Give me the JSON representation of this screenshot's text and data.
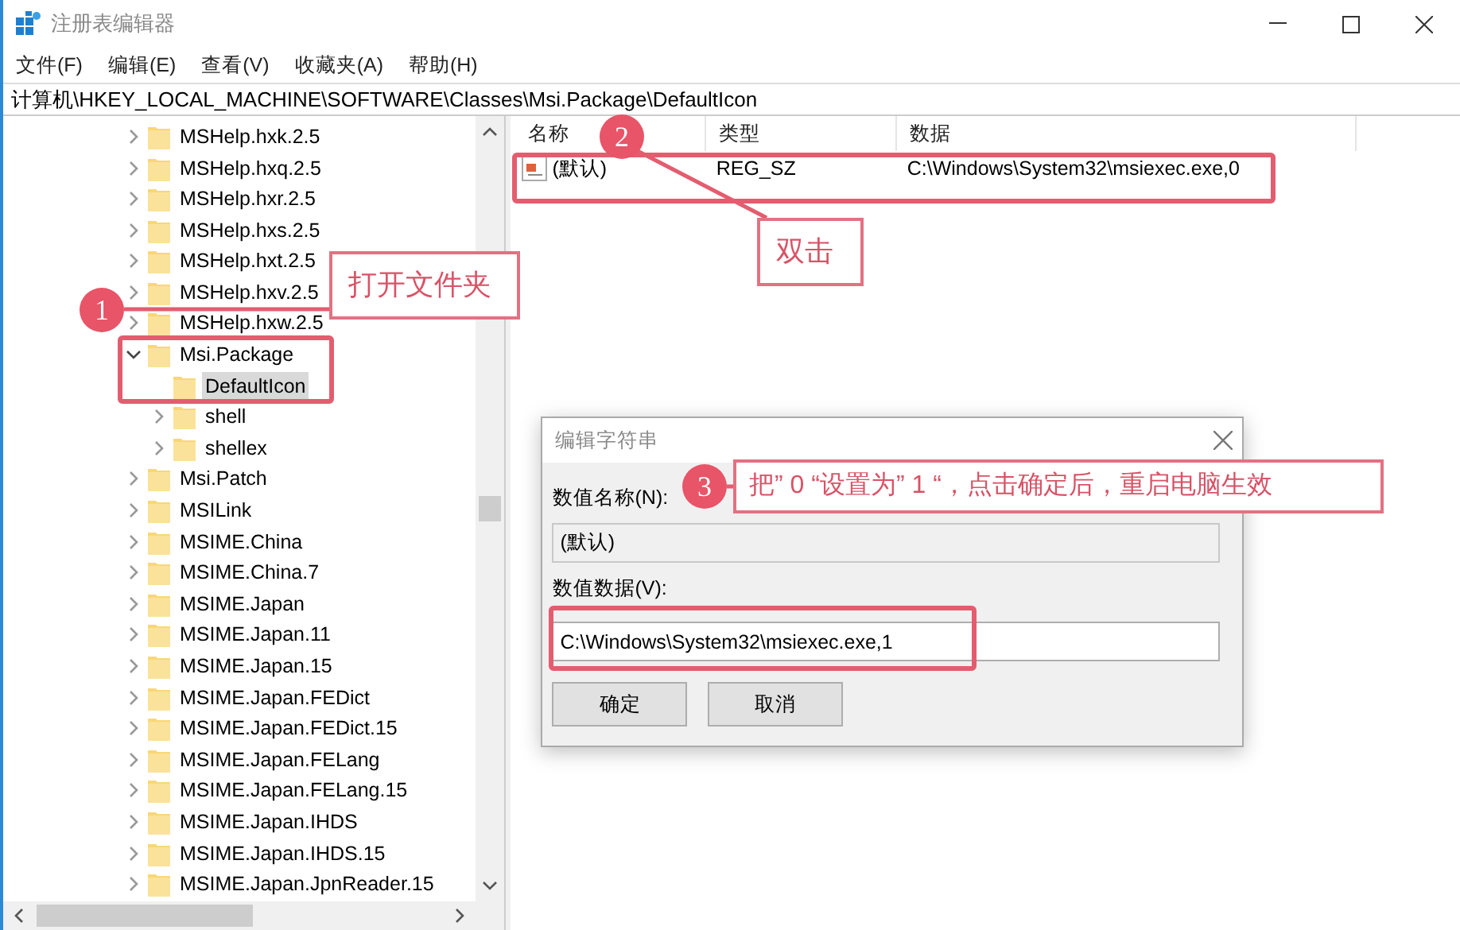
{
  "window": {
    "title": "注册表编辑器"
  },
  "menu": [
    "文件(F)",
    "编辑(E)",
    "查看(V)",
    "收藏夹(A)",
    "帮助(H)"
  ],
  "address": "计算机\\HKEY_LOCAL_MACHINE\\SOFTWARE\\Classes\\Msi.Package\\DefaultIcon",
  "tree": [
    {
      "label": "MSHelp.hxk.2.5",
      "expanded": false,
      "selected": false
    },
    {
      "label": "MSHelp.hxq.2.5",
      "expanded": false,
      "selected": false
    },
    {
      "label": "MSHelp.hxr.2.5",
      "expanded": false,
      "selected": false
    },
    {
      "label": "MSHelp.hxs.2.5",
      "expanded": false,
      "selected": false
    },
    {
      "label": "MSHelp.hxt.2.5",
      "expanded": false,
      "selected": false
    },
    {
      "label": "MSHelp.hxv.2.5",
      "expanded": false,
      "selected": false
    },
    {
      "label": "MSHelp.hxw.2.5",
      "expanded": false,
      "selected": false
    },
    {
      "label": "Msi.Package",
      "expanded": true,
      "selected": false,
      "children": [
        {
          "label": "DefaultIcon",
          "selected": true
        },
        {
          "label": "shell",
          "expanded": false,
          "selected": false
        },
        {
          "label": "shellex",
          "expanded": false,
          "selected": false
        }
      ]
    },
    {
      "label": "Msi.Patch",
      "expanded": false,
      "selected": false
    },
    {
      "label": "MSILink",
      "expanded": false,
      "selected": false
    },
    {
      "label": "MSIME.China",
      "expanded": false,
      "selected": false
    },
    {
      "label": "MSIME.China.7",
      "expanded": false,
      "selected": false
    },
    {
      "label": "MSIME.Japan",
      "expanded": false,
      "selected": false
    },
    {
      "label": "MSIME.Japan.11",
      "expanded": false,
      "selected": false
    },
    {
      "label": "MSIME.Japan.15",
      "expanded": false,
      "selected": false
    },
    {
      "label": "MSIME.Japan.FEDict",
      "expanded": false,
      "selected": false
    },
    {
      "label": "MSIME.Japan.FEDict.15",
      "expanded": false,
      "selected": false
    },
    {
      "label": "MSIME.Japan.FELang",
      "expanded": false,
      "selected": false
    },
    {
      "label": "MSIME.Japan.FELang.15",
      "expanded": false,
      "selected": false
    },
    {
      "label": "MSIME.Japan.IHDS",
      "expanded": false,
      "selected": false
    },
    {
      "label": "MSIME.Japan.IHDS.15",
      "expanded": false,
      "selected": false
    },
    {
      "label": "MSIME.Japan.JpnReader.15",
      "expanded": false,
      "selected": false
    }
  ],
  "values_table": {
    "columns": [
      "名称",
      "类型",
      "数据"
    ],
    "rows": [
      {
        "name": "(默认)",
        "type": "REG_SZ",
        "data": "C:\\Windows\\System32\\msiexec.exe,0"
      }
    ]
  },
  "dialog": {
    "title": "编辑字符串",
    "name_label": "数值名称(N):",
    "name_value": "(默认)",
    "data_label": "数值数据(V):",
    "data_value": "C:\\Windows\\System32\\msiexec.exe,1",
    "buttons": [
      "确定",
      "取消"
    ]
  },
  "annotations": [
    {
      "number": "1",
      "callout": "打开文件夹"
    },
    {
      "number": "2",
      "callout": "双击"
    },
    {
      "number": "3",
      "callout": "把” 0 “设置为” 1 “，点击确定后，重启电脑生效"
    }
  ]
}
